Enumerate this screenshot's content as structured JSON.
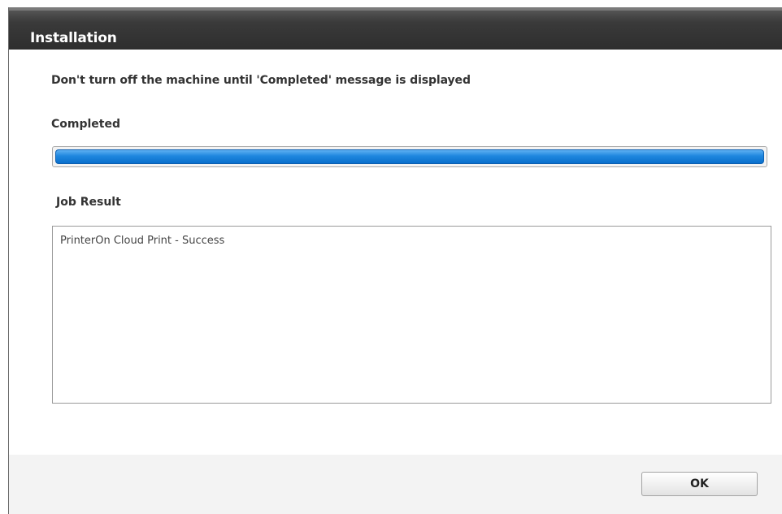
{
  "dialog": {
    "title": "Installation",
    "warning": "Don't turn off the machine until 'Completed' message is displayed",
    "status": "Completed",
    "progress": {
      "percent": 100,
      "color": "#1e86de"
    },
    "job_result": {
      "label": "Job Result",
      "lines": [
        "PrinterOn Cloud Print - Success"
      ]
    },
    "buttons": {
      "ok_label": "OK"
    }
  }
}
